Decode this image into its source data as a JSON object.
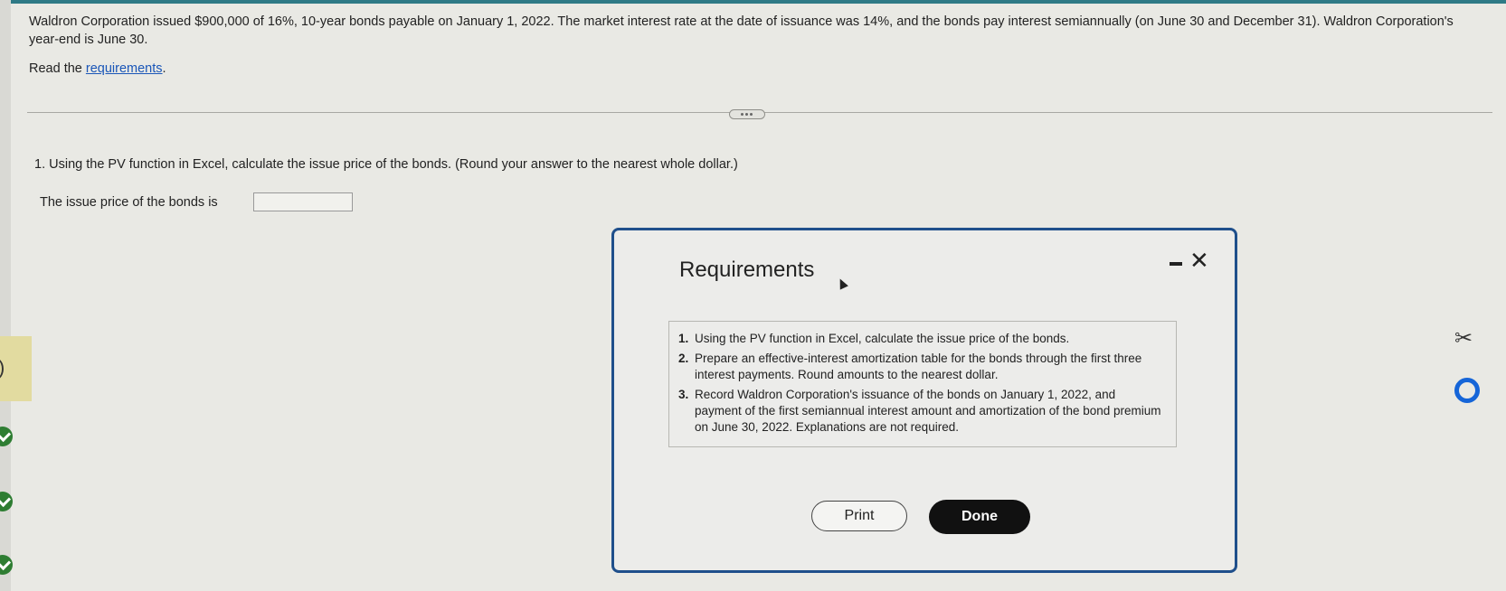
{
  "problem": {
    "text": "Waldron Corporation issued $900,000 of 16%, 10-year bonds payable on January 1, 2022. The market interest rate at the date of issuance was 14%, and the bonds pay interest semiannually (on June 30 and December 31). Waldron Corporation's year-end is June 30.",
    "read_prefix": "Read the ",
    "req_link": "requirements",
    "read_suffix": "."
  },
  "question": {
    "text": "1. Using the PV function in Excel, calculate the issue price of the bonds. (Round your answer to the nearest whole dollar.)",
    "issue_label": "The issue price of the bonds is",
    "issue_value": ""
  },
  "modal": {
    "title": "Requirements",
    "close": "✕",
    "requirements": [
      {
        "num": "1.",
        "text": "Using the PV function in Excel, calculate the issue price of the bonds."
      },
      {
        "num": "2.",
        "text": "Prepare an effective-interest amortization table for the bonds through the first three interest payments. Round amounts to the nearest dollar."
      },
      {
        "num": "3.",
        "text": "Record Waldron Corporation's issuance of the bonds on January 1, 2022, and payment of the first semiannual interest amount and amortization of the bond premium on June 30, 2022. Explanations are not required."
      }
    ],
    "print_label": "Print",
    "done_label": "Done"
  },
  "side": {
    "scissors_glyph": "✂",
    "left_paren": ")"
  },
  "colors": {
    "accent": "#1f4f8b",
    "link": "#1a56b8",
    "check": "#2e7d32",
    "circle_icon": "#1565d8"
  }
}
